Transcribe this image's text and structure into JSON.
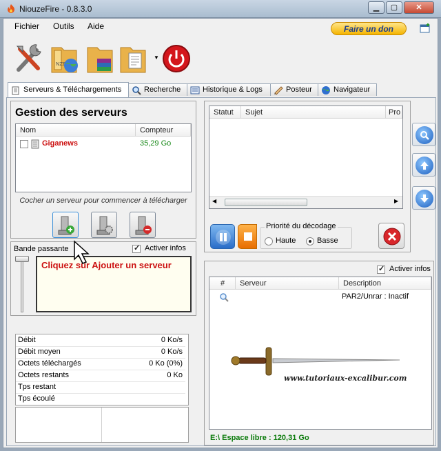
{
  "window": {
    "title": "NiouzeFire - 0.8.3.0"
  },
  "menu": {
    "file": "Fichier",
    "tools": "Outils",
    "help": "Aide",
    "donate": "Faire un don"
  },
  "tabs": [
    {
      "label": "Serveurs & Téléchargements"
    },
    {
      "label": "Recherche"
    },
    {
      "label": "Historique & Logs"
    },
    {
      "label": "Posteur"
    },
    {
      "label": "Navigateur"
    }
  ],
  "servers": {
    "heading": "Gestion des serveurs",
    "col_name": "Nom",
    "col_counter": "Compteur",
    "rows": [
      {
        "name": "Giganews",
        "counter": "35,29 Go"
      }
    ],
    "hint": "Cocher un serveur pour commencer à télécharger"
  },
  "bandwidth": {
    "label": "Bande passante",
    "activate": "Activer infos",
    "callout": "Cliquez sur Ajouter un serveur"
  },
  "stats": [
    {
      "key": "Débit",
      "value": "0 Ko/s"
    },
    {
      "key": "Débit moyen",
      "value": "0 Ko/s"
    },
    {
      "key": "Octets téléchargés",
      "value": "0 Ko (0%)"
    },
    {
      "key": "Octets restants",
      "value": "0 Ko"
    },
    {
      "key": "Tps restant",
      "value": ""
    },
    {
      "key": "Tps écoulé",
      "value": ""
    }
  ],
  "queue": {
    "col_status": "Statut",
    "col_subject": "Sujet",
    "col_progress": "Pro"
  },
  "decode": {
    "legend": "Priorité du décodage",
    "high": "Haute",
    "low": "Basse",
    "selected": "Basse"
  },
  "workers": {
    "activate": "Activer infos",
    "col_num": "#",
    "col_server": "Serveur",
    "col_desc": "Description",
    "rows": [
      {
        "server": "",
        "description": "PAR2/Unrar : Inactif"
      }
    ]
  },
  "watermark": "www.tutoriaux-excalibur.com",
  "status": {
    "free_space": "E:\\ Espace libre : 120,31 Go"
  },
  "colors": {
    "accent_red": "#cc1111",
    "server_green": "#1a8a1a",
    "status_green": "#0a7a0a"
  }
}
